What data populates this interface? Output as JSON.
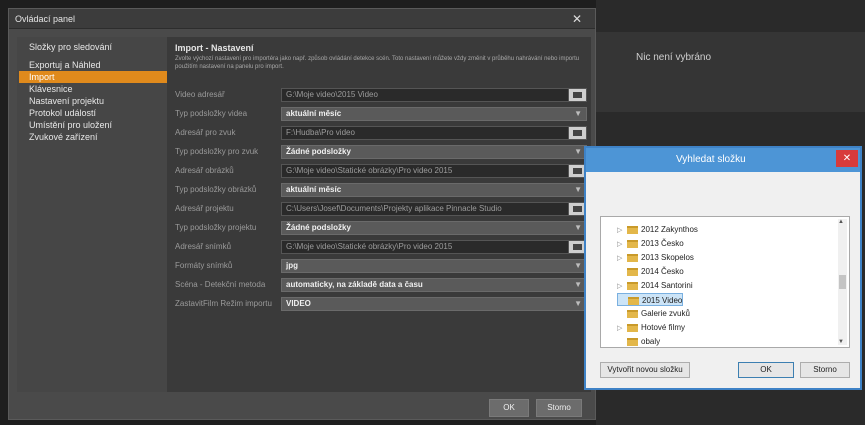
{
  "background": {
    "top_text": "",
    "nothing_selected": "Nic není vybráno"
  },
  "dialog": {
    "title": "Ovládací panel",
    "close": "✕",
    "nav": [
      {
        "label": "Složky pro sledování",
        "active": false
      },
      {
        "label": "Exportuj a Náhled",
        "active": false
      },
      {
        "label": "Import",
        "active": true
      },
      {
        "label": "Klávesnice",
        "active": false
      },
      {
        "label": "Nastavení projektu",
        "active": false
      },
      {
        "label": "Protokol událostí",
        "active": false
      },
      {
        "label": "Umístění pro uložení",
        "active": false
      },
      {
        "label": "Zvukové zařízení",
        "active": false
      }
    ],
    "panel": {
      "title": "Import - Nastavení",
      "description": "Zvolte výchozí nastavení pro importéra jako např. způsob ovládání detekce scén. Toto nastavení můžete vždy změnit v průběhu nahrávání nebo importu použitím nastavení na panelu pro import.",
      "rows": [
        {
          "label": "Video adresář",
          "type": "path",
          "value": "G:\\Moje video\\2015 Video"
        },
        {
          "label": "Typ podsložky videa",
          "type": "select",
          "value": "aktuální měsíc"
        },
        {
          "label": "Adresář pro zvuk",
          "type": "path",
          "value": "F:\\Hudba\\Pro video"
        },
        {
          "label": "Typ podsložky pro zvuk",
          "type": "select",
          "value": "Žádné podsložky"
        },
        {
          "label": "Adresář obrázků",
          "type": "path",
          "value": "G:\\Moje video\\Statické obrázky\\Pro video 2015"
        },
        {
          "label": "Typ podsložky obrázků",
          "type": "select",
          "value": "aktuální měsíc"
        },
        {
          "label": "Adresář projektu",
          "type": "path",
          "value": "C:\\Users\\Josef\\Documents\\Projekty aplikace Pinnacle Studio"
        },
        {
          "label": "Typ podsložky projektu",
          "type": "select",
          "value": "Žádné podsložky"
        },
        {
          "label": "Adresář snímků",
          "type": "path",
          "value": "G:\\Moje video\\Statické obrázky\\Pro video 2015"
        },
        {
          "label": "Formáty snímků",
          "type": "select",
          "value": "jpg"
        },
        {
          "label": "Scéna - Detekční metoda",
          "type": "select",
          "value": "automaticky, na základě data a času"
        },
        {
          "label": "ZastavitFilm Režim importu",
          "type": "select",
          "value": "VIDEO"
        }
      ]
    },
    "ok_label": "OK",
    "cancel_label": "Storno"
  },
  "folder_dialog": {
    "title": "Vyhledat složku",
    "close": "✕",
    "folders": [
      {
        "name": "2012 Zakynthos",
        "expandable": true,
        "selected": false
      },
      {
        "name": "2013 Česko",
        "expandable": true,
        "selected": false
      },
      {
        "name": "2013 Skopelos",
        "expandable": true,
        "selected": false
      },
      {
        "name": "2014 Česko",
        "expandable": false,
        "selected": false
      },
      {
        "name": "2014 Santorini",
        "expandable": true,
        "selected": false
      },
      {
        "name": "2015 Video",
        "expandable": false,
        "selected": true
      },
      {
        "name": "Galerie zvuků",
        "expandable": false,
        "selected": false
      },
      {
        "name": "Hotové filmy",
        "expandable": true,
        "selected": false
      },
      {
        "name": "obaly",
        "expandable": false,
        "selected": false
      }
    ],
    "new_folder_label": "Vytvořit novou složku",
    "ok_label": "OK",
    "cancel_label": "Storno"
  }
}
